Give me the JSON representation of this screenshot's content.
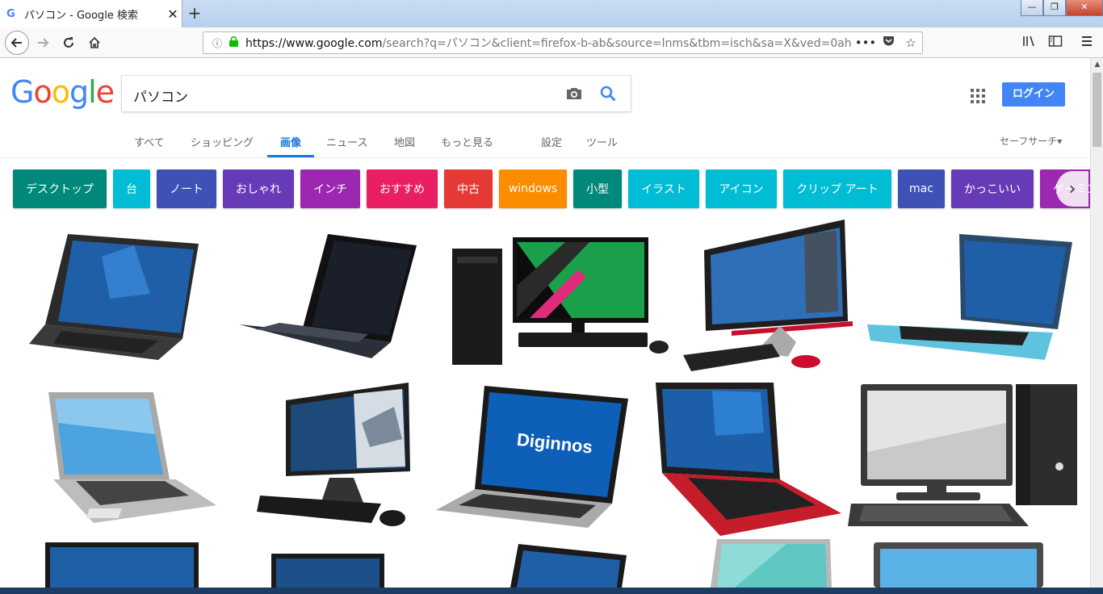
{
  "browser": {
    "tab_title": "パソコン - Google 検索",
    "tab_favicon": "G",
    "new_tab_symbol": "+",
    "url_host": "https://www.google.com",
    "url_path": "/search?q=パソコン&client=firefox-b-ab&source=lnms&tbm=isch&sa=X&ved=0ah"
  },
  "search": {
    "query": "パソコン"
  },
  "header": {
    "logo_letters": [
      "G",
      "o",
      "o",
      "g",
      "l",
      "e"
    ],
    "login_label": "ログイン"
  },
  "tabs": [
    {
      "label": "すべて"
    },
    {
      "label": "ショッピング"
    },
    {
      "label": "画像"
    },
    {
      "label": "ニュース"
    },
    {
      "label": "地図"
    },
    {
      "label": "もっと見る"
    },
    {
      "label": "設定"
    },
    {
      "label": "ツール"
    }
  ],
  "safesearch_label": "セーフサーチ▾",
  "chips": [
    {
      "label": "デスクトップ",
      "color": "#00897b"
    },
    {
      "label": "台",
      "color": "#00bcd4"
    },
    {
      "label": "ノート",
      "color": "#3f51b5"
    },
    {
      "label": "おしゃれ",
      "color": "#673ab7"
    },
    {
      "label": "インチ",
      "color": "#9c27b0"
    },
    {
      "label": "おすすめ",
      "color": "#e91e63"
    },
    {
      "label": "中古",
      "color": "#e53935"
    },
    {
      "label": "windows",
      "color": "#fb8c00"
    },
    {
      "label": "小型",
      "color": "#00897b"
    },
    {
      "label": "イラスト",
      "color": "#00bcd4"
    },
    {
      "label": "アイコン",
      "color": "#00bcd4"
    },
    {
      "label": "クリップ アート",
      "color": "#00bcd4"
    },
    {
      "label": "mac",
      "color": "#3f51b5"
    },
    {
      "label": "かっこいい",
      "color": "#673ab7"
    },
    {
      "label": "ゲーミング",
      "color": "#9c27b0"
    }
  ],
  "thumbnail_text": {
    "diginnos": "Diginnos"
  }
}
